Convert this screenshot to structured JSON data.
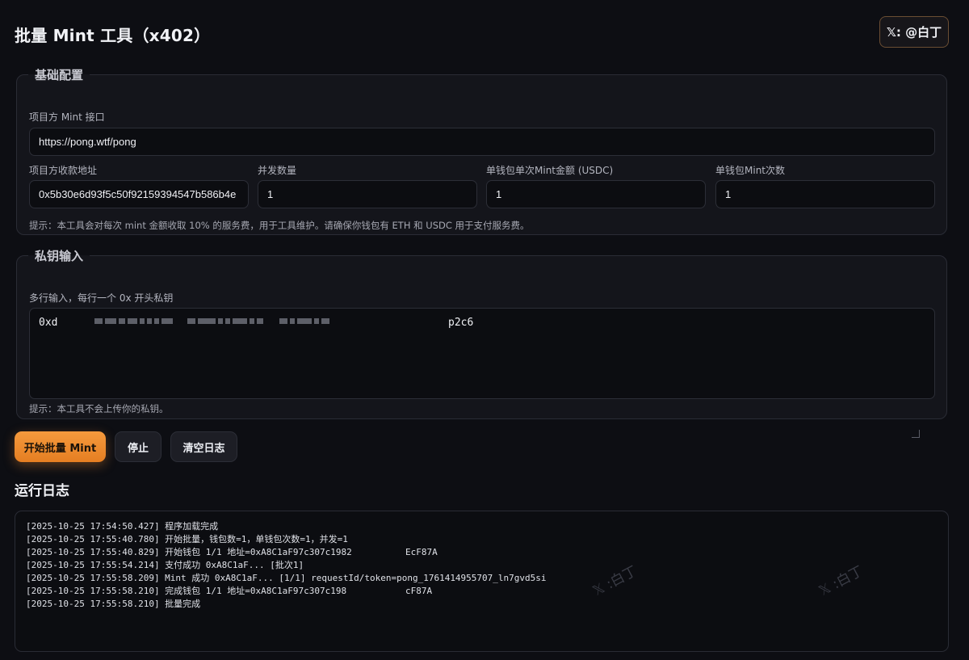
{
  "header": {
    "title": "批量 Mint 工具（x402）",
    "social_button": "𝕏: @白丁"
  },
  "config": {
    "legend": "基础配置",
    "endpoint_label": "项目方 Mint 接口",
    "endpoint_value": "https://pong.wtf/pong",
    "address_label": "项目方收款地址",
    "address_value": "0x5b30e6d93f5c50f92159394547b586b4e",
    "concurrency_label": "并发数量",
    "concurrency_value": "1",
    "amount_label": "单钱包单次Mint金额 (USDC)",
    "amount_value": "1",
    "times_label": "单钱包Mint次数",
    "times_value": "1",
    "hint": "提示：本工具会对每次 mint 金额收取 10% 的服务费，用于工具维护。请确保你钱包有 ETH 和 USDC 用于支付服务费。"
  },
  "keys": {
    "legend": "私钥输入",
    "label": "多行输入，每行一个 0x 开头私钥",
    "value_prefix": "0xd",
    "value_suffix": "p2c6",
    "hint": "提示：本工具不会上传你的私钥。"
  },
  "actions": {
    "start": "开始批量 Mint",
    "stop": "停止",
    "clear": "清空日志"
  },
  "log": {
    "title": "运行日志",
    "lines": [
      "[2025-10-25 17:54:50.427] 程序加载完成",
      "[2025-10-25 17:55:40.780] 开始批量，钱包数=1，单钱包次数=1，并发=1",
      "[2025-10-25 17:55:40.829] 开始钱包 1/1 地址=0xA8C1aF97c307c1982          EcF87A",
      "[2025-10-25 17:55:54.214] 支付成功 0xA8C1aF... [批次1]",
      "[2025-10-25 17:55:58.209] Mint 成功 0xA8C1aF... [1/1] requestId/token=pong_1761414955707_ln7gvd5si",
      "[2025-10-25 17:55:58.210] 完成钱包 1/1 地址=0xA8C1aF97c307c198           cF87A",
      "[2025-10-25 17:55:58.210] 批量完成"
    ],
    "watermark": "𝕏 :白丁"
  }
}
